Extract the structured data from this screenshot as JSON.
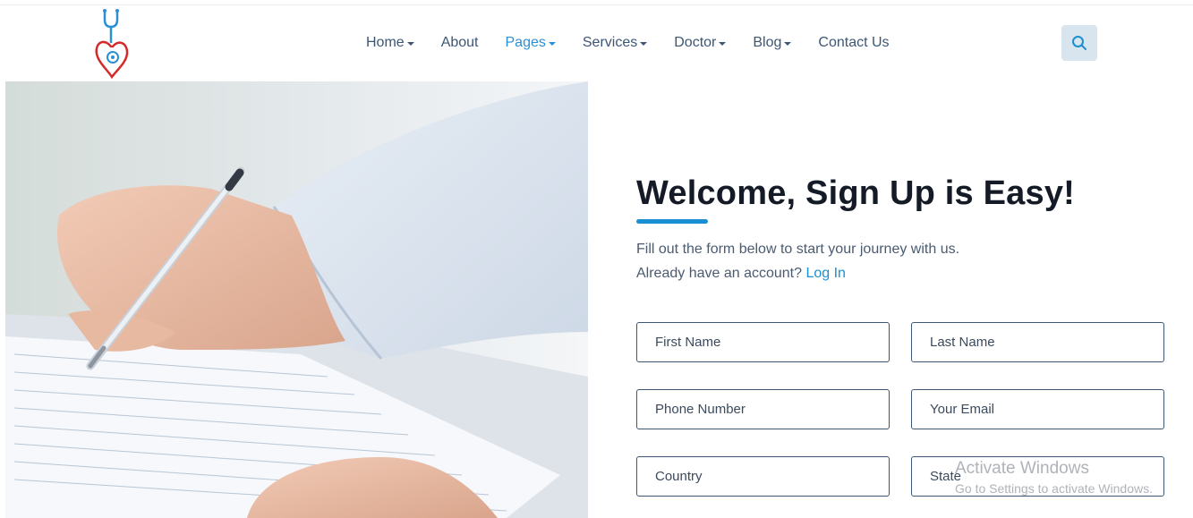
{
  "header": {
    "logo_icon": "stethoscope-heart-logo",
    "nav": [
      {
        "label": "Home",
        "dropdown": true
      },
      {
        "label": "About",
        "dropdown": false
      },
      {
        "label": "Pages",
        "dropdown": true,
        "active": true
      },
      {
        "label": "Services",
        "dropdown": true
      },
      {
        "label": "Doctor",
        "dropdown": true
      },
      {
        "label": "Blog",
        "dropdown": true
      },
      {
        "label": "Contact Us",
        "dropdown": false
      }
    ],
    "search_icon": "search-icon"
  },
  "hero": {
    "image": "hand-writing-on-form-photo"
  },
  "signup": {
    "title": "Welcome, Sign Up is Easy!",
    "subtitle": "Fill out the form below to start your journey with us.",
    "account_prompt": "Already have an account?",
    "login_link": "Log In",
    "fields": {
      "first_name": "First Name",
      "last_name": "Last Name",
      "phone": "Phone Number",
      "email": "Your Email",
      "country": "Country",
      "state": "State"
    }
  },
  "watermark": {
    "title": "Activate Windows",
    "subtitle": "Go to Settings to activate Windows."
  },
  "colors": {
    "accent": "#1a8fd1",
    "nav_text": "#3c5674",
    "heading": "#151b26",
    "search_bg": "#d9e5ee",
    "logo_red": "#d42a2a",
    "logo_blue": "#2b8fd6"
  }
}
